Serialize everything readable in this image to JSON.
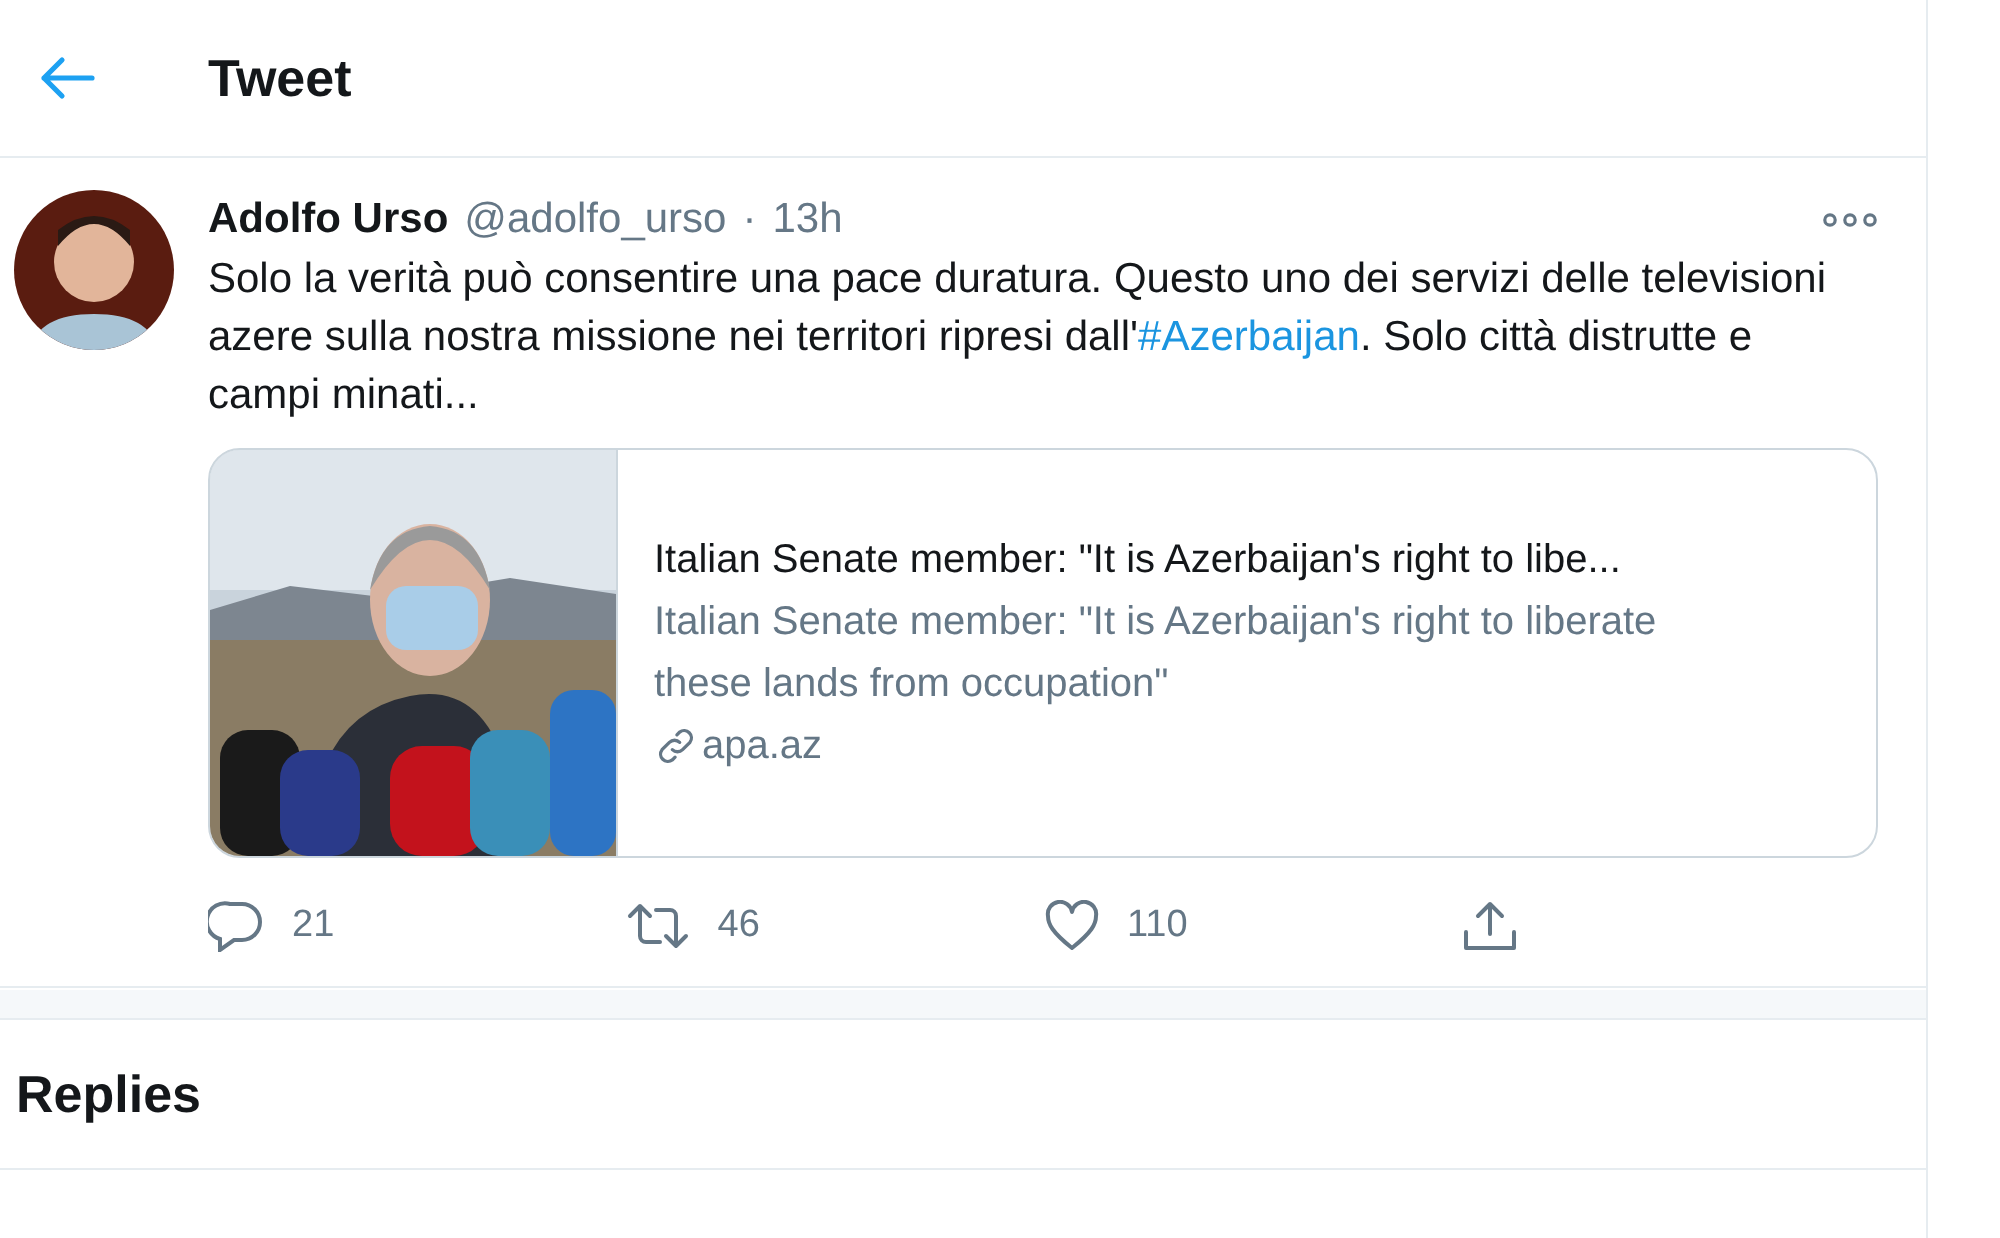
{
  "header": {
    "title": "Tweet"
  },
  "tweet": {
    "author": "Adolfo Urso",
    "handle": "@adolfo_urso",
    "separator": "·",
    "time": "13h",
    "text_parts": [
      {
        "kind": "plain",
        "text": "Solo la verità può consentire una pace duratura. Questo uno dei servizi delle televisioni azere sulla nostra missione nei territori ripresi dall'"
      },
      {
        "kind": "hashtag",
        "text": "#Azerbaijan"
      },
      {
        "kind": "plain",
        "text": ". Solo città distrutte e campi minati..."
      }
    ],
    "card": {
      "title": "Italian Senate member: \"It is Azerbaijan's right to libe...",
      "description": "Italian Senate member: \"It is Azerbaijan's right to liberate these lands from occupation\"",
      "domain": "apa.az"
    },
    "actions": [
      {
        "kind": "reply",
        "count": "21"
      },
      {
        "kind": "retweet",
        "count": "46"
      },
      {
        "kind": "like",
        "count": "110"
      },
      {
        "kind": "share"
      }
    ]
  },
  "replies": {
    "title": "Replies"
  }
}
